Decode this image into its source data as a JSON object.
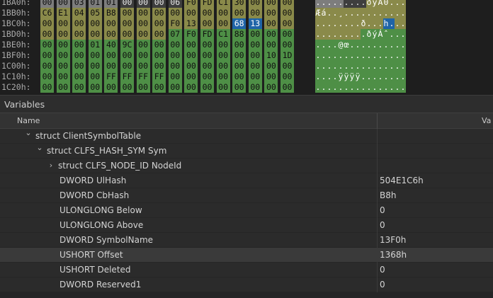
{
  "hex_editor": {
    "rows": [
      {
        "offset": "1BA0h:",
        "bytes": [
          "00",
          "00",
          "03",
          "01",
          "01",
          "00",
          "00",
          "00",
          "06",
          "F0",
          "FD",
          "C1",
          "30",
          "00",
          "00",
          "00"
        ],
        "ascii": [
          ".",
          ".",
          ".",
          ".",
          ".",
          ".",
          ".",
          ".",
          ".",
          "ð",
          "ý",
          "Á",
          "0",
          ".",
          ".",
          "."
        ]
      },
      {
        "offset": "1BB0h:",
        "bytes": [
          "C6",
          "E1",
          "04",
          "05",
          "B8",
          "00",
          "00",
          "00",
          "00",
          "00",
          "00",
          "00",
          "00",
          "00",
          "00",
          "00"
        ],
        "ascii": [
          "Æ",
          "á",
          ".",
          ".",
          "¸",
          ".",
          ".",
          ".",
          ".",
          ".",
          ".",
          ".",
          ".",
          ".",
          ".",
          "."
        ]
      },
      {
        "offset": "1BC0h:",
        "bytes": [
          "00",
          "00",
          "00",
          "00",
          "00",
          "00",
          "00",
          "00",
          "F0",
          "13",
          "00",
          "00",
          "68",
          "13",
          "00",
          "00"
        ],
        "ascii": [
          ".",
          ".",
          ".",
          ".",
          ".",
          ".",
          ".",
          ".",
          "ð",
          ".",
          ".",
          ".",
          "h",
          ".",
          ".",
          "."
        ]
      },
      {
        "offset": "1BD0h:",
        "bytes": [
          "00",
          "00",
          "00",
          "00",
          "00",
          "00",
          "00",
          "00",
          "07",
          "F0",
          "FD",
          "C1",
          "88",
          "00",
          "00",
          "00"
        ],
        "ascii": [
          ".",
          ".",
          ".",
          ".",
          ".",
          ".",
          ".",
          ".",
          ".",
          "ð",
          "ý",
          "Á",
          "ˆ",
          ".",
          ".",
          "."
        ]
      },
      {
        "offset": "1BE0h:",
        "bytes": [
          "00",
          "00",
          "00",
          "01",
          "40",
          "9C",
          "00",
          "00",
          "00",
          "00",
          "00",
          "00",
          "00",
          "00",
          "00",
          "00"
        ],
        "ascii": [
          ".",
          ".",
          ".",
          ".",
          "@",
          "œ",
          ".",
          ".",
          ".",
          ".",
          ".",
          ".",
          ".",
          ".",
          ".",
          "."
        ]
      },
      {
        "offset": "1BF0h:",
        "bytes": [
          "00",
          "00",
          "00",
          "00",
          "00",
          "00",
          "00",
          "00",
          "00",
          "00",
          "00",
          "00",
          "00",
          "00",
          "10",
          "1D"
        ],
        "ascii": [
          ".",
          ".",
          ".",
          ".",
          ".",
          ".",
          ".",
          ".",
          ".",
          ".",
          ".",
          ".",
          ".",
          ".",
          ".",
          "."
        ]
      },
      {
        "offset": "1C00h:",
        "bytes": [
          "00",
          "00",
          "00",
          "00",
          "00",
          "00",
          "00",
          "00",
          "00",
          "00",
          "00",
          "00",
          "00",
          "00",
          "00",
          "00"
        ],
        "ascii": [
          ".",
          ".",
          ".",
          ".",
          ".",
          ".",
          ".",
          ".",
          ".",
          ".",
          ".",
          ".",
          ".",
          ".",
          ".",
          "."
        ]
      },
      {
        "offset": "1C10h:",
        "bytes": [
          "00",
          "00",
          "00",
          "00",
          "FF",
          "FF",
          "FF",
          "FF",
          "00",
          "00",
          "00",
          "00",
          "00",
          "00",
          "00",
          "00"
        ],
        "ascii": [
          ".",
          ".",
          ".",
          ".",
          "ÿ",
          "ÿ",
          "ÿ",
          "ÿ",
          ".",
          ".",
          ".",
          ".",
          ".",
          ".",
          ".",
          "."
        ]
      },
      {
        "offset": "1C20h:",
        "bytes": [
          "00",
          "00",
          "00",
          "00",
          "00",
          "00",
          "00",
          "00",
          "00",
          "00",
          "00",
          "00",
          "00",
          "00",
          "00",
          "00"
        ],
        "ascii": [
          ".",
          ".",
          ".",
          ".",
          ".",
          ".",
          ".",
          ".",
          ".",
          ".",
          ".",
          ".",
          ".",
          ".",
          ".",
          "."
        ]
      }
    ]
  },
  "variables": {
    "title": "Variables",
    "columns": {
      "name": "Name",
      "value": "Va"
    },
    "rows": [
      {
        "name": "struct ClientSymbolTable",
        "value": "",
        "expander": "expanded"
      },
      {
        "name": "struct CLFS_HASH_SYM Sym",
        "value": "",
        "expander": "expanded"
      },
      {
        "name": "struct CLFS_NODE_ID NodeId",
        "value": "",
        "expander": "collapsed"
      },
      {
        "name": "DWORD UlHash",
        "value": "504E1C6h",
        "expander": "none"
      },
      {
        "name": "DWORD CbHash",
        "value": "B8h",
        "expander": "none"
      },
      {
        "name": "ULONGLONG Below",
        "value": "0",
        "expander": "none"
      },
      {
        "name": "ULONGLONG Above",
        "value": "0",
        "expander": "none"
      },
      {
        "name": "DWORD SymbolName",
        "value": "13F0h",
        "expander": "none"
      },
      {
        "name": "USHORT Offset",
        "value": "1368h",
        "expander": "none"
      },
      {
        "name": "USHORT Deleted",
        "value": "0",
        "expander": "none"
      },
      {
        "name": "DWORD Reserved1",
        "value": "0",
        "expander": "none"
      }
    ]
  }
}
